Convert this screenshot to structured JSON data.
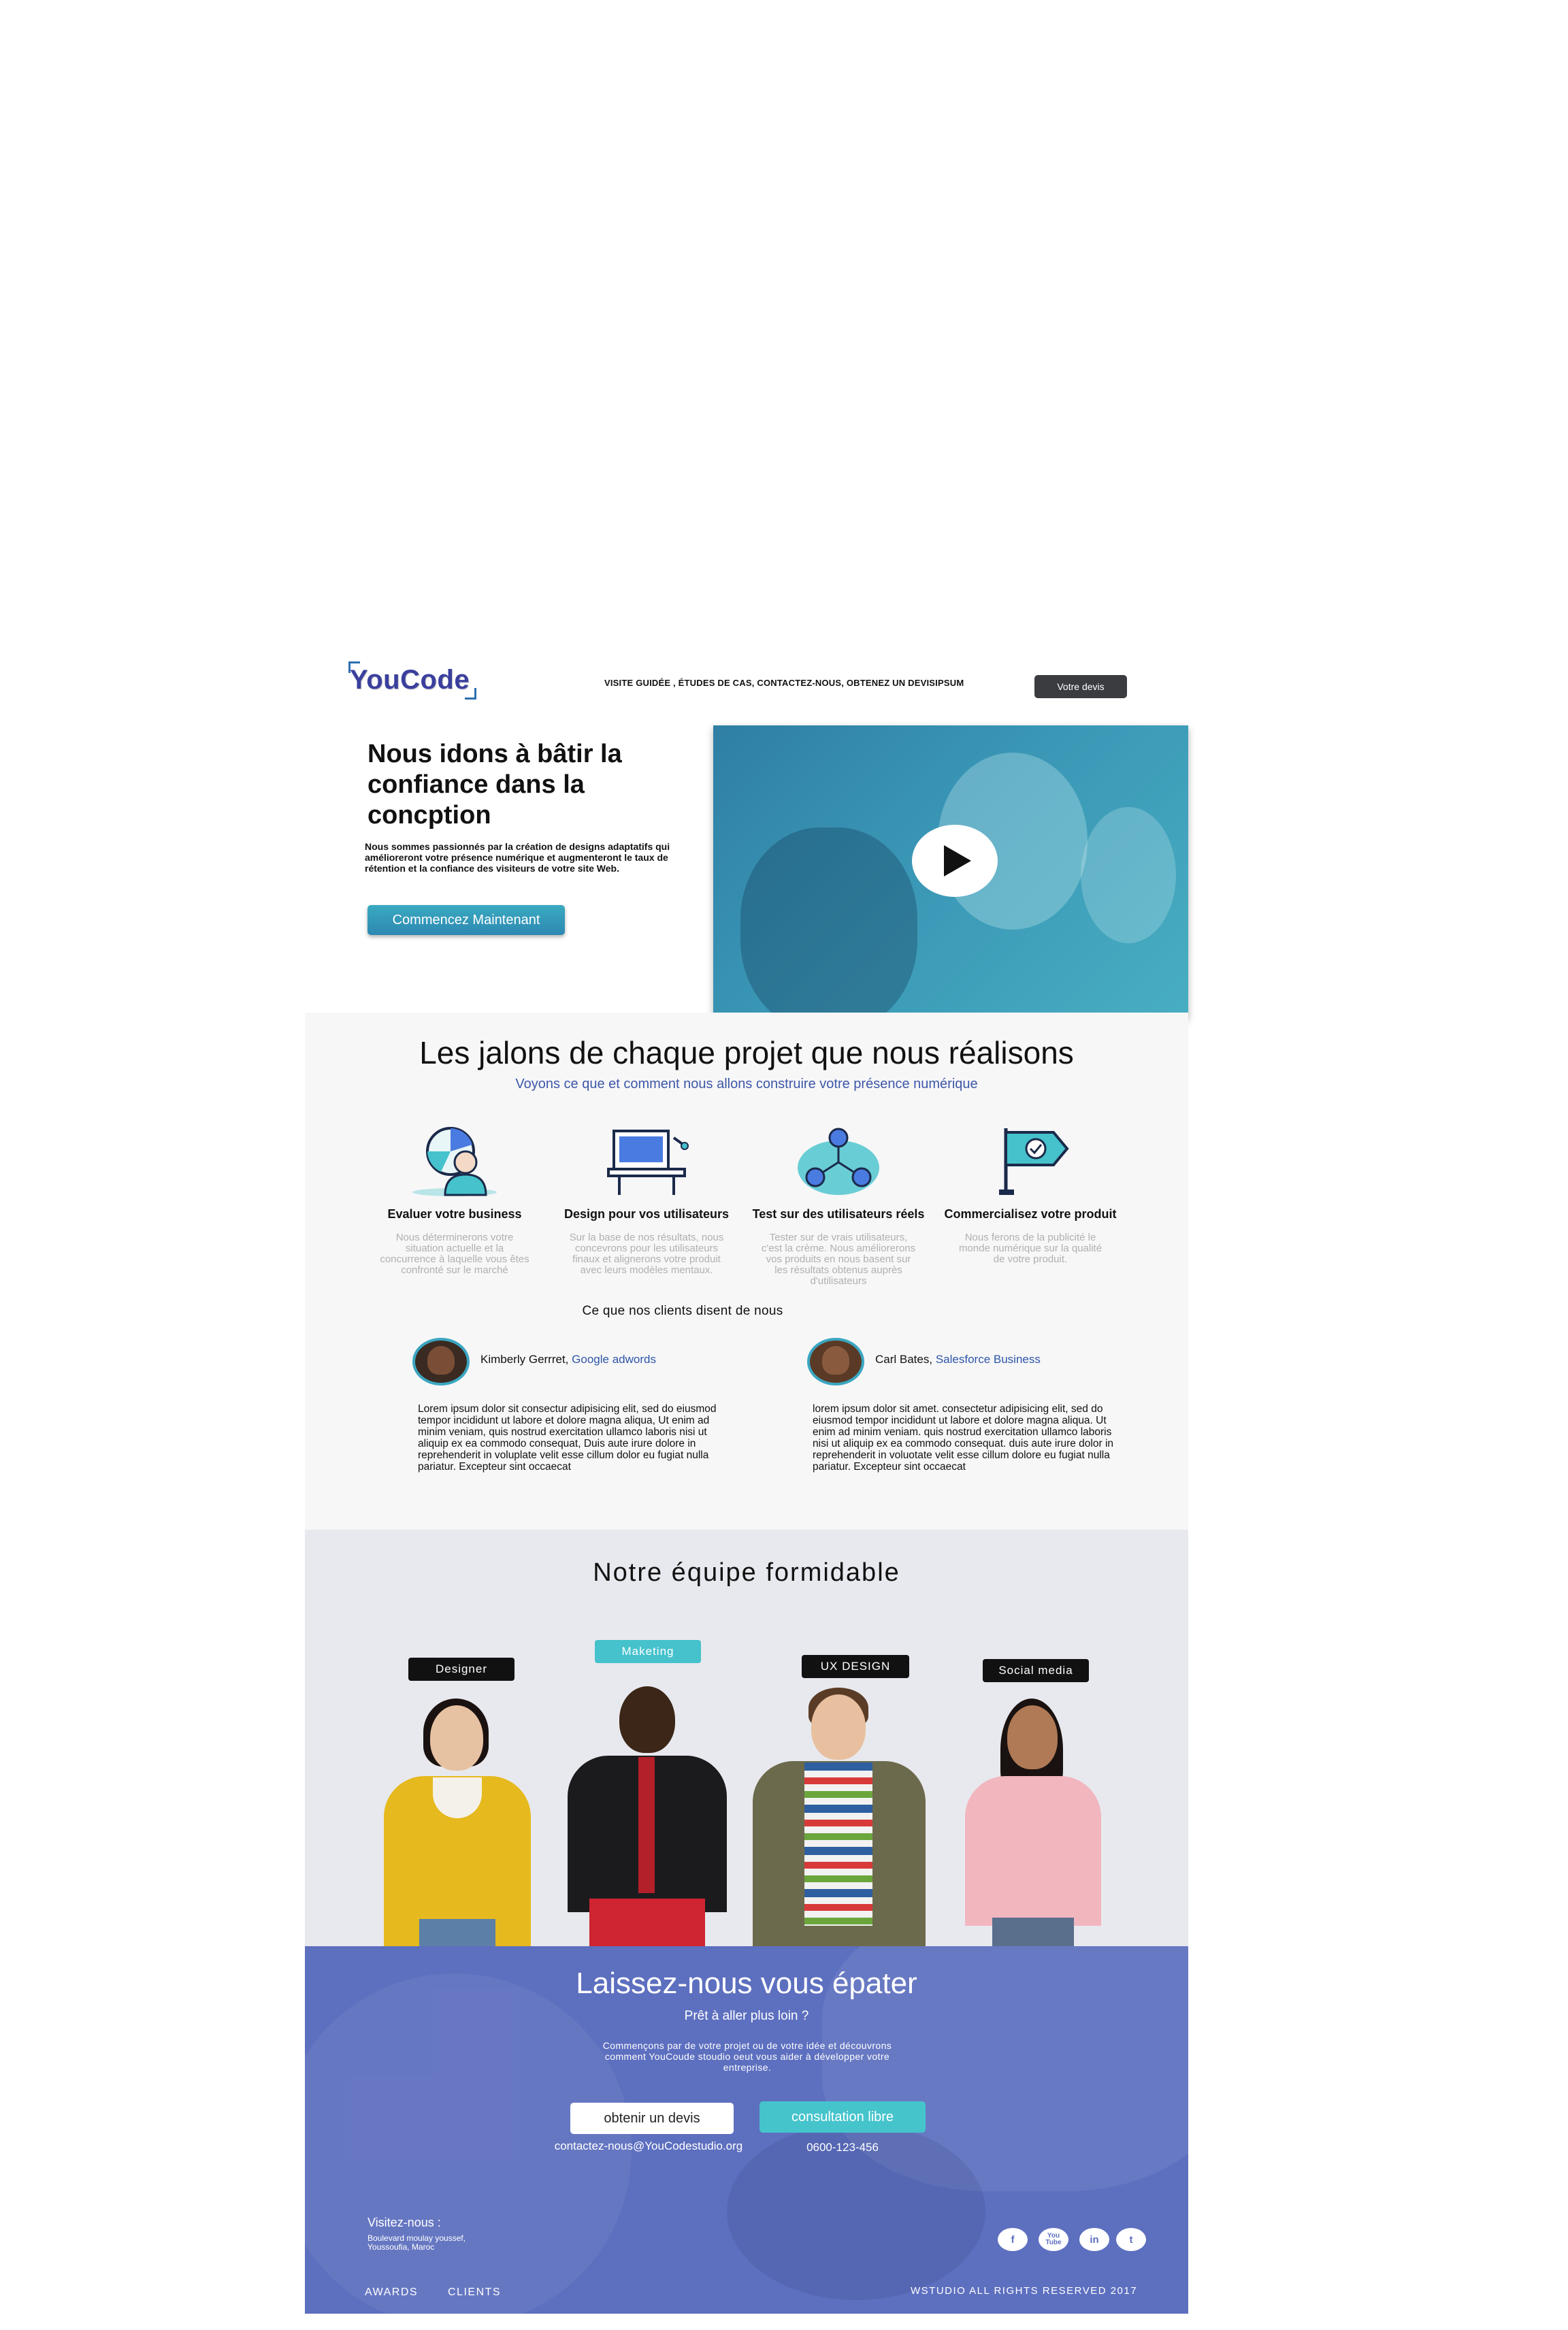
{
  "header": {
    "logo_text": "YouCode",
    "nav_text": "VISITE GUIDÉE , ÉTUDES DE CAS, CONTACTEZ-NOUS, OBTENEZ UN DEVISIPSUM",
    "quote_button": "Votre devis"
  },
  "hero": {
    "title": "Nous idons à bâtir la confiance dans la concption",
    "text": "Nous sommes passionnés par la création de designs adaptatifs qui amélioreront votre présence numérique et augmenteront le taux de rétention et la confiance des visiteurs de votre site Web.",
    "cta_button": "Commencez Maintenant",
    "video_icon": "play-icon"
  },
  "milestones": {
    "title": "Les jalons de chaque projet que nous réalisons",
    "subtitle": "Voyons ce que et comment nous allons construire votre présence numérique",
    "steps": [
      {
        "icon": "analysis-icon",
        "title": "Evaluer votre business",
        "text": "Nous déterminerons votre situation actuelle et la concurrence à laquelle vous êtes confronté sur le marché"
      },
      {
        "icon": "desktop-design-icon",
        "title": "Design pour vos utilisateurs",
        "text": "Sur la base de nos résultats, nous concevrons pour les utilisateurs finaux et alignerons votre produit avec leurs modèles mentaux."
      },
      {
        "icon": "user-network-icon",
        "title": "Test sur des utilisateurs réels",
        "text": "Tester sur de vrais utilisateurs, c'est la crème. Nous améliorerons vos produits en nous basent sur les résultats obtenus auprès d'utilisateurs"
      },
      {
        "icon": "flag-check-icon",
        "title": "Commercialisez votre produit",
        "text": "Nous ferons de la publicité le monde numérique sur la qualité de votre produit."
      }
    ]
  },
  "clients": {
    "title": "Ce que nos clients disent de nous",
    "testimonials": [
      {
        "name": "Kimberly Gerrret,",
        "company": "Google adwords",
        "text": "Lorem ipsum dolor sit consectur adipisicing elit, sed do eiusmod tempor incididunt ut labore et dolore magna aliqua, Ut enim ad minim veniam, quis nostrud exercitation ullamco laboris nisi ut aliquip ex ea commodo consequat, Duis aute irure dolore in reprehenderit in voluplate velit esse cillum dolor eu fugiat nulla pariatur. Excepteur sint occaecat"
      },
      {
        "name": "Carl Bates,",
        "company": "Salesforce Business",
        "text": "lorem ipsum dolor sit amet. consectetur adipisicing elit, sed do eiusmod tempor incididunt ut labore et dolore magna aliqua. Ut enim ad minim veniam. quis nostrud exercitation ullamco laboris nisi ut aliquip ex ea commodo consequat. duis aute irure dolor in reprehenderit in voluotate velit esse cillum dolore eu fugiat nulla pariatur. Excepteur sint occaecat"
      }
    ]
  },
  "team": {
    "title": "Notre équipe formidable",
    "roles": [
      "Designer",
      "Maketing",
      "UX DESIGN",
      "Social media"
    ]
  },
  "cta": {
    "title": "Laissez-nous vous épater",
    "question": "Prêt à aller plus loin ?",
    "text": "Commençons par de votre projet ou de votre idée et découvrons comment YouCoude stoudio oeut vous aider à développer votre entreprise.",
    "quote_button": "obtenir un devis",
    "consult_button": "consultation libre",
    "email": "contactez-nous@YouCodestudio.org",
    "phone": "0600-123-456"
  },
  "footer": {
    "visit_title": "Visitez-nous :",
    "address_line1": "Boulevard moulay youssef,",
    "address_line2": "Youssoufia, Maroc",
    "social": [
      {
        "icon": "facebook-icon",
        "label": "f"
      },
      {
        "icon": "youtube-icon",
        "label": "You Tube"
      },
      {
        "icon": "linkedin-icon",
        "label": "in"
      },
      {
        "icon": "twitter-icon",
        "label": "t"
      }
    ],
    "links": [
      "AWARDS",
      "CLIENTS"
    ],
    "copyright": "WSTUDIO ALL RIGHTS RESERVED 2017"
  },
  "colors": {
    "primary": "#5d6fbf",
    "accent": "#45c2cc",
    "link": "#2e55a8",
    "dark_button": "#3a3c40"
  }
}
